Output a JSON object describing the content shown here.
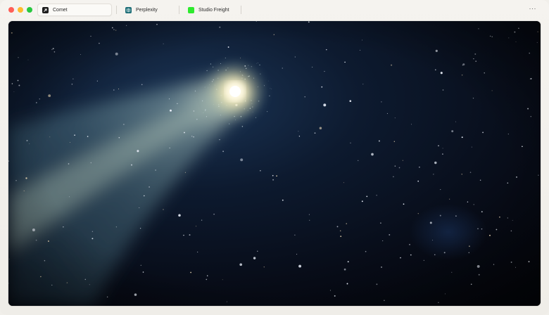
{
  "window": {
    "colors": {
      "close": "#ff5f57",
      "minimize": "#febc2e",
      "maximize": "#28c840"
    }
  },
  "tabs": [
    {
      "label": "Comet",
      "icon": "comet-logo-icon",
      "active": true
    },
    {
      "label": "Perplexity",
      "icon": "perplexity-logo-icon",
      "active": false
    },
    {
      "label": "Studio Freight",
      "icon": "studio-freight-logo-icon",
      "active": false
    }
  ],
  "toolbar": {
    "more_label": "···"
  },
  "content": {
    "image": "comet-night-sky-image"
  }
}
